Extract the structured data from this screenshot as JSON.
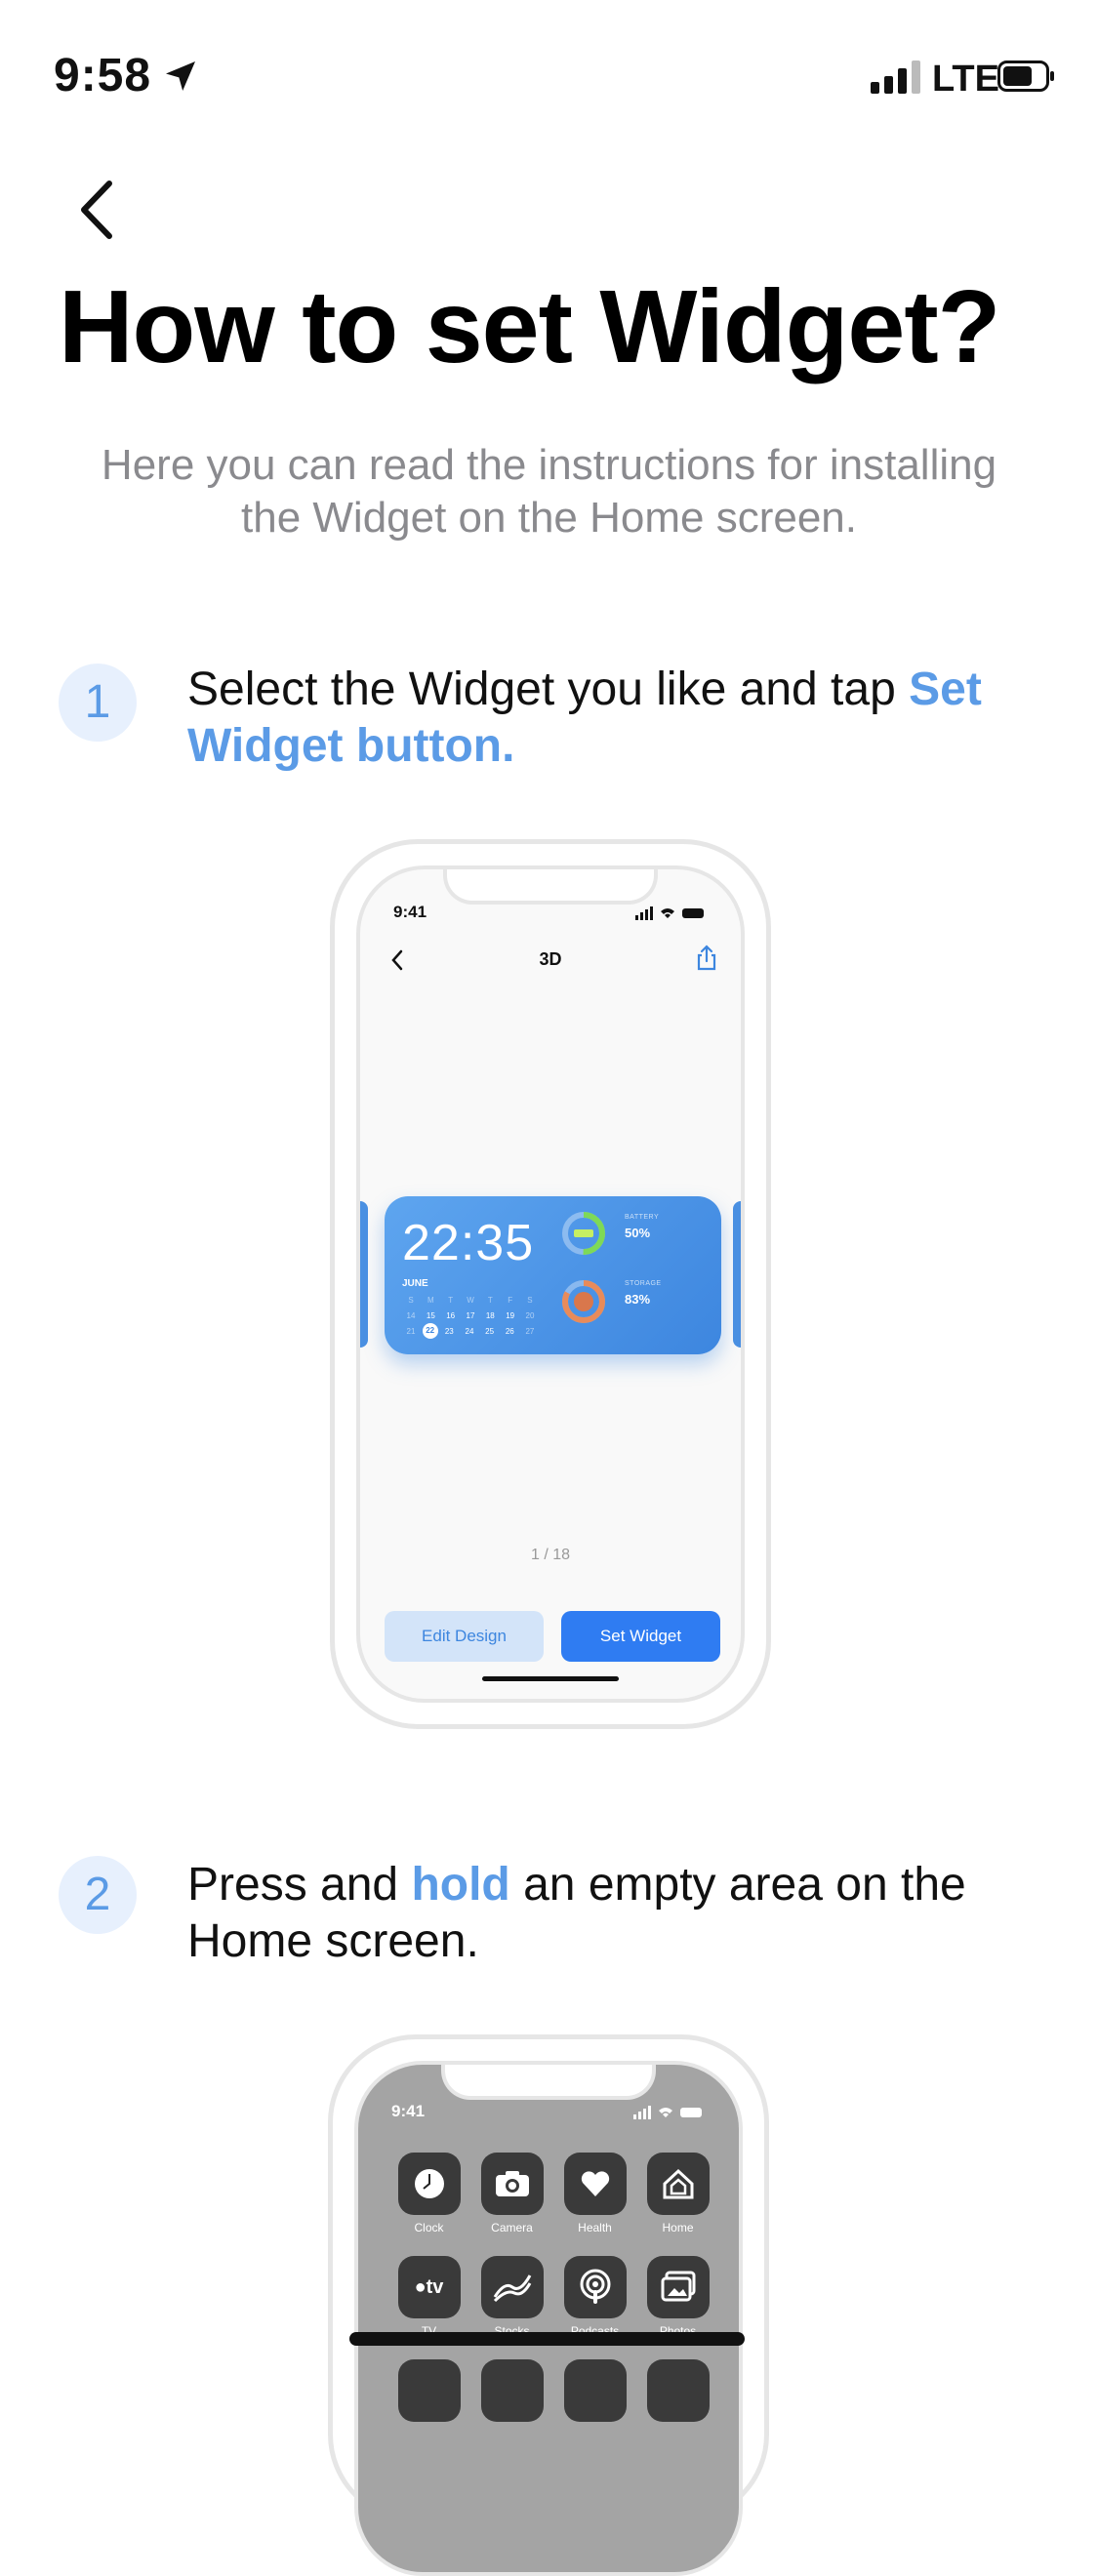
{
  "status_bar": {
    "time": "9:58",
    "network": "LTE",
    "battery_level": 0.7
  },
  "header": {
    "title": "How to set Widget?",
    "subtitle": "Here you can read the instructions for installing the Widget on the Home screen."
  },
  "steps": [
    {
      "number": "1",
      "text_before": "Select the Widget you like and tap ",
      "highlight": "Set Widget button.",
      "text_after": ""
    },
    {
      "number": "2",
      "text_before": "Press and ",
      "highlight": "hold",
      "text_after": " an empty area on the Home screen."
    }
  ],
  "mockup1": {
    "time": "9:41",
    "title": "3D",
    "widget": {
      "clock": "22:35",
      "month": "JUNE",
      "weekdays": [
        "S",
        "M",
        "T",
        "W",
        "T",
        "F",
        "S"
      ],
      "week1": [
        "14",
        "15",
        "16",
        "17",
        "18",
        "19",
        "20"
      ],
      "week2": [
        "21",
        "22",
        "23",
        "24",
        "25",
        "26",
        "27"
      ],
      "battery_label": "BATTERY",
      "battery_value": "50%",
      "storage_label": "STORAGE",
      "storage_value": "83%"
    },
    "pager": "1 / 18",
    "edit_label": "Edit Design",
    "set_label": "Set Widget"
  },
  "mockup2": {
    "time": "9:41",
    "apps": [
      {
        "label": "Clock",
        "icon": "clock-icon"
      },
      {
        "label": "Camera",
        "icon": "camera-icon"
      },
      {
        "label": "Health",
        "icon": "heart-icon"
      },
      {
        "label": "Home",
        "icon": "home-icon"
      },
      {
        "label": "TV",
        "icon": "tv-icon"
      },
      {
        "label": "Stocks",
        "icon": "stocks-icon"
      },
      {
        "label": "Podcasts",
        "icon": "podcasts-icon"
      },
      {
        "label": "Photos",
        "icon": "photos-icon"
      }
    ]
  },
  "colors": {
    "accent": "#5b9be6",
    "button_blue": "#2f7cf2",
    "widget_blue": "#3d86df",
    "step_badge_bg": "#e7f0fd"
  }
}
